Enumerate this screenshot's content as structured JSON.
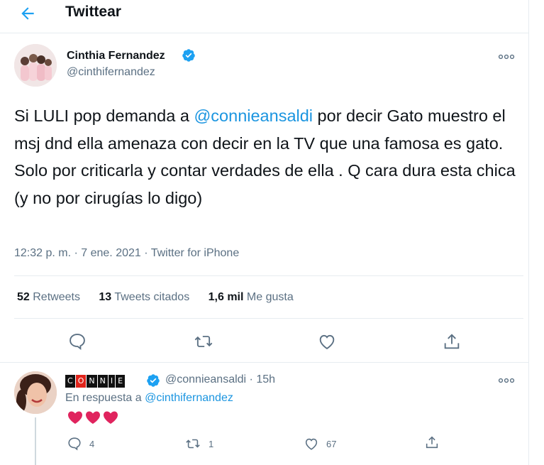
{
  "header": {
    "title": "Twittear"
  },
  "tweet": {
    "author_name": "Cinthia Fernandez",
    "author_handle": "@cinthifernandez",
    "text_1": "Si LULI pop demanda a ",
    "mention": "@connieansaldi",
    "text_2": " por decir Gato muestro el msj dnd ella amenaza con decir en la TV que una famosa es gato. Solo por criticarla y contar verdades de ella . Q cara dura esta chica (y no por cirugías lo digo)",
    "timestamp": "12:32 p. m. · 7 ene. 2021 · Twitter for iPhone",
    "stats": {
      "retweets_count": "52",
      "retweets_label": "Retweets",
      "quotes_count": "13",
      "quotes_label": "Tweets citados",
      "likes_count": "1,6 mil",
      "likes_label": "Me gusta"
    },
    "icons": [
      "reply-icon",
      "retweet-icon",
      "like-icon",
      "share-icon"
    ]
  },
  "reply": {
    "display_name": "CONNIE",
    "display_letters": [
      "C",
      "O",
      "N",
      "N",
      "I",
      "E"
    ],
    "handle_time": "@connieansaldi · 15h",
    "reply_to_prefix": "En respuesta a ",
    "reply_to_handle": "@cinthifernandez",
    "hearts": [
      "❤",
      "❤",
      "❤"
    ],
    "reply_count": "4",
    "retweet_count": "1",
    "like_count": "67"
  },
  "colors": {
    "accent": "#1b95e0",
    "text": "#0f1419",
    "muted": "#5b7083",
    "verified": "#1da1f2",
    "heart": "#e0245e",
    "border": "#e6ecf0"
  }
}
